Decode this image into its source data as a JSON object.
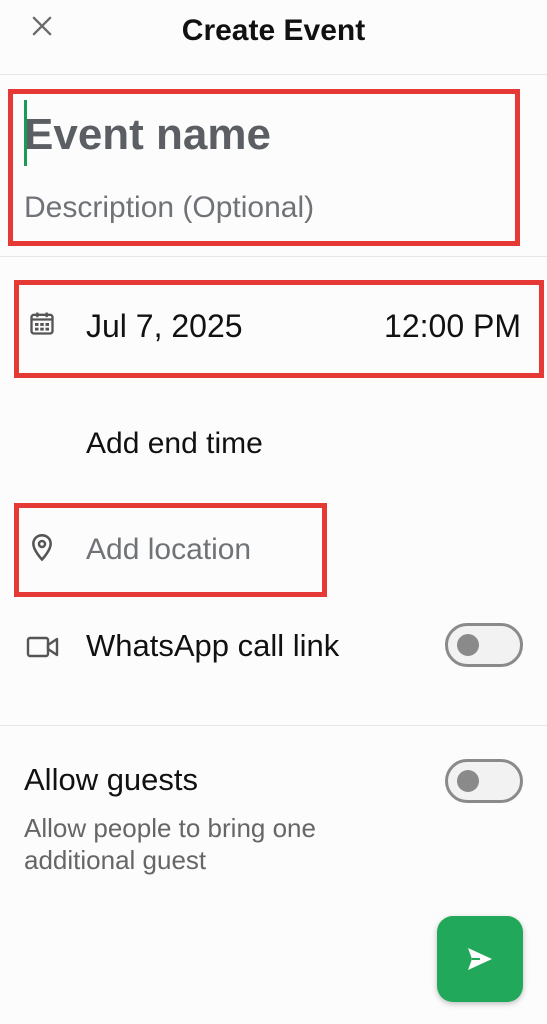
{
  "header": {
    "title": "Create Event",
    "close_icon": "close-icon"
  },
  "event": {
    "name_placeholder": "Event name",
    "description_placeholder": "Description (Optional)"
  },
  "datetime": {
    "date": "Jul 7, 2025",
    "time": "12:00 PM",
    "calendar_icon": "calendar-icon",
    "add_end_time": "Add end time"
  },
  "location": {
    "placeholder": "Add location",
    "icon": "location-pin-icon"
  },
  "call": {
    "label": "WhatsApp call link",
    "icon": "video-camera-icon",
    "enabled": false
  },
  "guests": {
    "title": "Allow guests",
    "subtitle": "Allow people to bring one additional guest",
    "enabled": false
  },
  "actions": {
    "send_icon": "send-icon"
  },
  "colors": {
    "accent_green": "#22a85a",
    "highlight_red": "#e53935",
    "cursor_green": "#1a9b57"
  }
}
